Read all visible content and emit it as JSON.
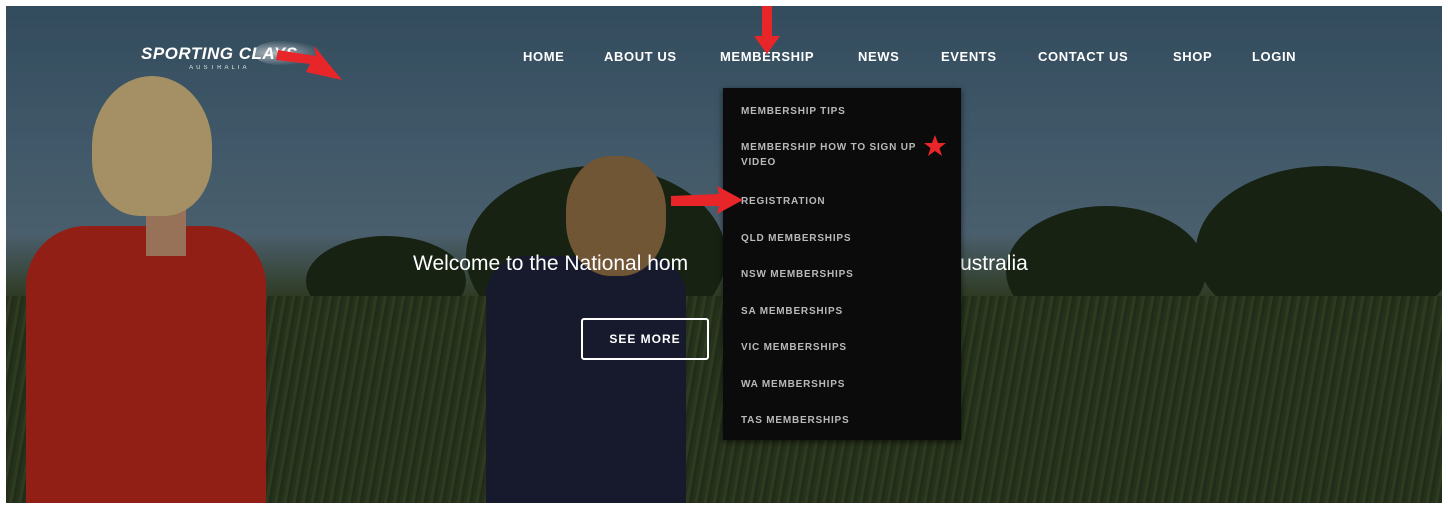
{
  "brand": {
    "logo_text": "SPORTING CLAYS",
    "logo_subtext": "AUSTRALIA"
  },
  "nav": {
    "items": [
      {
        "label": "HOME"
      },
      {
        "label": "ABOUT US"
      },
      {
        "label": "MEMBERSHIP"
      },
      {
        "label": "NEWS"
      },
      {
        "label": "EVENTS"
      },
      {
        "label": "CONTACT US"
      },
      {
        "label": "SHOP"
      },
      {
        "label": "LOGIN"
      }
    ]
  },
  "membership_menu": {
    "items": [
      {
        "label": "MEMBERSHIP TIPS"
      },
      {
        "label": "MEMBERSHIP HOW TO SIGN UP VIDEO"
      },
      {
        "label": "REGISTRATION"
      },
      {
        "label": "QLD MEMBERSHIPS"
      },
      {
        "label": "NSW MEMBERSHIPS"
      },
      {
        "label": "SA MEMBERSHIPS"
      },
      {
        "label": "VIC MEMBERSHIPS"
      },
      {
        "label": "WA MEMBERSHIPS"
      },
      {
        "label": "TAS MEMBERSHIPS"
      }
    ]
  },
  "hero": {
    "welcome_left": "Welcome to the National hom",
    "welcome_right": "Australia",
    "cta_label": "SEE MORE"
  },
  "annotation": {
    "color": "#e8262a",
    "icons": [
      "arrow-logo-icon",
      "arrow-membership-icon",
      "star-icon",
      "arrow-registration-icon"
    ]
  }
}
